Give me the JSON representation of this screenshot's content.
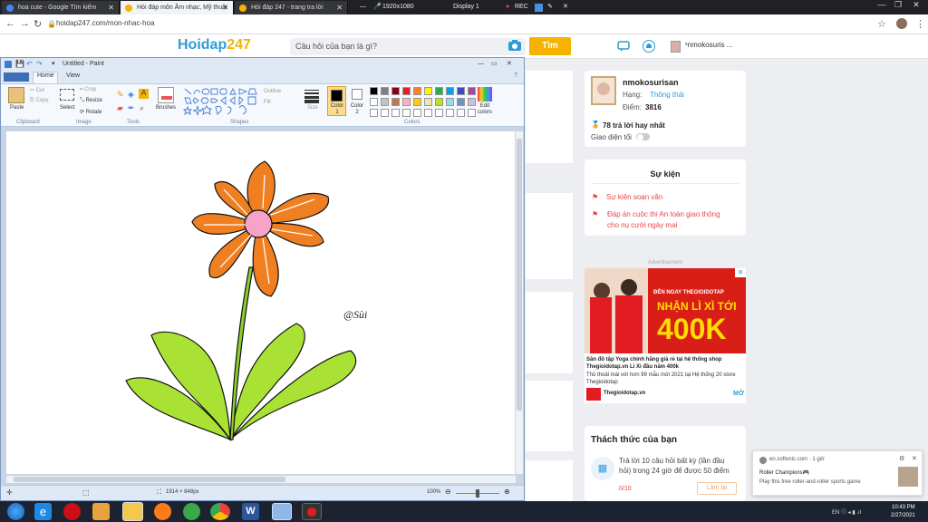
{
  "browser": {
    "tabs": [
      {
        "title": "hoa cute - Google Tìm kiếm",
        "active": false
      },
      {
        "title": "Hỏi đáp môn Âm nhạc, Mỹ thuật",
        "active": true
      },
      {
        "title": "Hỏi đáp 247 - trang tra lời",
        "active": false
      }
    ],
    "capture": {
      "resolution": "1920x1080",
      "display": "Display 1",
      "rec": "REC"
    },
    "url": "hoidap247.com/mon-nhac-hoa"
  },
  "site": {
    "logo_main": "Hoidap",
    "logo_num": "247",
    "search_placeholder": "Câu hỏi của bạn là gì?",
    "search_button": "Tìm",
    "top_user": "ˣnmokosuris ..."
  },
  "profile": {
    "name": "nmokosurisan",
    "rank_label": "Hạng:",
    "rank_value": "Thông thái",
    "score_label": "Điểm:",
    "score_value": "3816",
    "best_answers": "78 trả lời hay nhất",
    "dark_mode": "Giao diện tối"
  },
  "events": {
    "title": "Sự kiện",
    "items": [
      "Sự kiện soạn văn",
      "Đáp án cuộc thi An toàn giao thông",
      "cho nụ cười ngày mai"
    ]
  },
  "ad": {
    "label": "Advertisement",
    "banner_top": "ĐẾN NGAY THEGIOIDOTAP",
    "banner_mid": "NHẬN LÌ XÌ TỚI",
    "banner_amount": "400K",
    "headline": "Sân đồ tập Yoga chính hãng giá rẻ tại hệ thống shop Thegioidotap.vn Lì Xì đầu năm 400k",
    "body": "Thủ thoải mái với hơn 99 mẫu mới 2021 tại Hệ thống 20 store Thegioidotap",
    "brand": "Thegioidotap.vn",
    "cta": "MỞ"
  },
  "challenge": {
    "title": "Thách thức của bạn",
    "text": "Trả lời 10 câu hỏi bất kỳ (lần đầu hỏi) trong 24 giờ để được 50 điểm",
    "progress": "0/10",
    "button": "Làm lại"
  },
  "notification": {
    "source": "en.softonic.com · 1 giờ",
    "title": "Roller Champions🎮",
    "body": "Play this free roller-and-roller sports game"
  },
  "paint": {
    "title": "Untitled - Paint",
    "tabs": [
      "Home",
      "View"
    ],
    "groups": [
      "Clipboard",
      "Image",
      "Tools",
      "Shapes",
      "Colors"
    ],
    "buttons": {
      "paste": "Paste",
      "cut": "Cut",
      "copy": "Copy",
      "select": "Select",
      "crop": "Crop",
      "resize": "Resize",
      "rotate": "Rotate",
      "brushes": "Brushes",
      "outline": "Outline",
      "fill": "Fill",
      "size": "Size",
      "color1": "Color 1",
      "color2": "Color 2",
      "edit_colors": "Edit colors"
    },
    "palette": [
      "#000000",
      "#7f7f7f",
      "#880015",
      "#ed1c24",
      "#ff7f27",
      "#fff200",
      "#22b14c",
      "#00a2e8",
      "#3f48cc",
      "#a349a4",
      "#ffffff",
      "#c3c3c3",
      "#b97a57",
      "#ffaec9",
      "#ffc90e",
      "#efe4b0",
      "#b5e61d",
      "#99d9ea",
      "#7092be",
      "#c8bfe7",
      "#ffffff",
      "#ffffff",
      "#ffffff",
      "#ffffff",
      "#ffffff",
      "#ffffff",
      "#ffffff",
      "#ffffff",
      "#ffffff",
      "#ffffff"
    ],
    "signature": "@Sùi",
    "canvas_size": "1914 × 848px",
    "zoom": "100%"
  },
  "taskbar": {
    "time": "10:43 PM",
    "date": "2/27/2021"
  },
  "colors": {
    "petal": "#f07f22",
    "center": "#f5a3c7",
    "leaf": "#a9e234",
    "stem": "#8ccf2c",
    "brand_yellow": "#f5b300",
    "brand_blue": "#2f9bd6"
  }
}
